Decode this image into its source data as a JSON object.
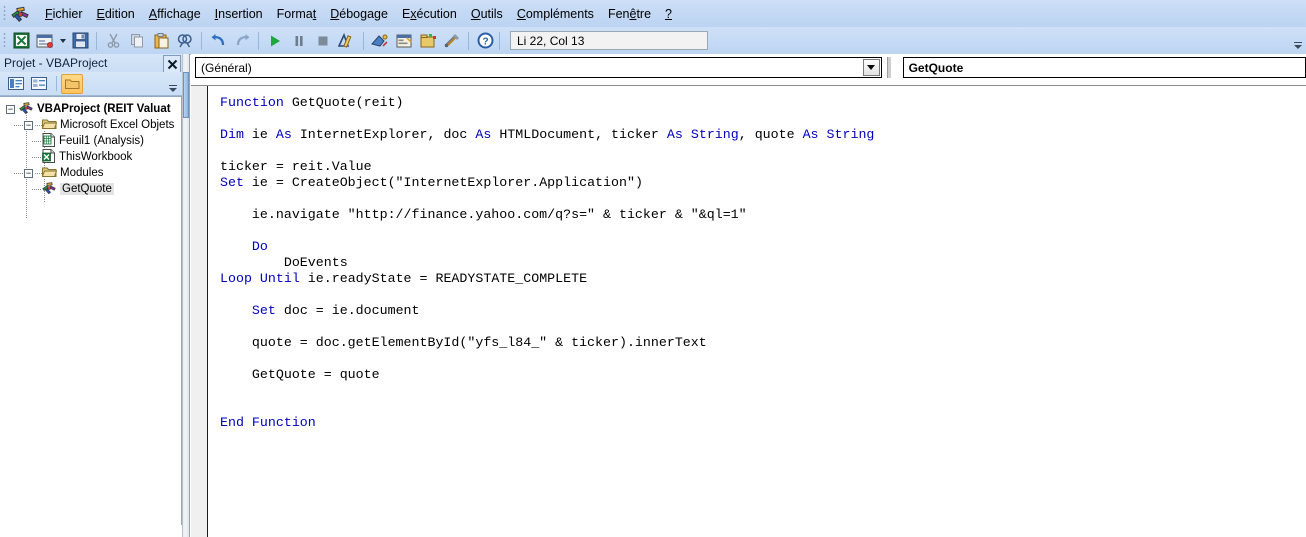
{
  "window": {
    "app_icon": "vba-logo-icon"
  },
  "menubar": {
    "items": [
      {
        "label": "Fichier",
        "accel": "F"
      },
      {
        "label": "Edition",
        "accel": "E"
      },
      {
        "label": "Affichage",
        "accel": "A"
      },
      {
        "label": "Insertion",
        "accel": "I"
      },
      {
        "label": "Format",
        "accel": "t"
      },
      {
        "label": "Débogage",
        "accel": "D"
      },
      {
        "label": "Exécution",
        "accel": "x"
      },
      {
        "label": "Outils",
        "accel": "O"
      },
      {
        "label": "Compléments",
        "accel": "C"
      },
      {
        "label": "Fenêtre",
        "accel": "ê"
      },
      {
        "label": "?",
        "accel": "?"
      }
    ]
  },
  "toolbar": {
    "buttons": [
      {
        "name": "view-excel-icon",
        "glyph": "excel"
      },
      {
        "name": "insert-userform-icon",
        "glyph": "userform"
      },
      {
        "name": "insert-dropdown-caret-icon",
        "glyph": "caret"
      },
      {
        "name": "save-icon",
        "glyph": "save"
      },
      {
        "name": "cut-icon",
        "glyph": "cut"
      },
      {
        "name": "copy-icon",
        "glyph": "copy"
      },
      {
        "name": "paste-icon",
        "glyph": "paste"
      },
      {
        "name": "find-icon",
        "glyph": "find"
      },
      {
        "name": "undo-icon",
        "glyph": "undo"
      },
      {
        "name": "redo-icon",
        "glyph": "redo"
      },
      {
        "name": "run-icon",
        "glyph": "run"
      },
      {
        "name": "pause-icon",
        "glyph": "pause"
      },
      {
        "name": "stop-icon",
        "glyph": "stop"
      },
      {
        "name": "design-mode-icon",
        "glyph": "design"
      },
      {
        "name": "project-explorer-icon",
        "glyph": "projexp"
      },
      {
        "name": "properties-window-icon",
        "glyph": "props"
      },
      {
        "name": "object-browser-icon",
        "glyph": "objbrowser"
      },
      {
        "name": "toolbox-icon",
        "glyph": "toolbox"
      },
      {
        "name": "help-icon",
        "glyph": "help"
      }
    ],
    "position_indicator": "Li 22, Col 13"
  },
  "project_explorer": {
    "title": "Projet - VBAProject",
    "close_label": "×",
    "toolbar_buttons": [
      {
        "name": "view-code-icon"
      },
      {
        "name": "view-object-icon"
      },
      {
        "name": "toggle-folders-icon"
      }
    ],
    "tree": {
      "root": {
        "label": "VBAProject (REIT Valuat",
        "expander": "−",
        "icon": "vbaproject-icon"
      },
      "groups": [
        {
          "label": "Microsoft Excel Objets",
          "expander": "−",
          "icon": "folder-icon",
          "children": [
            {
              "label": "Feuil1 (Analysis)",
              "icon": "worksheet-icon",
              "selected": false
            },
            {
              "label": "ThisWorkbook",
              "icon": "workbook-icon",
              "selected": false
            }
          ]
        },
        {
          "label": "Modules",
          "expander": "−",
          "icon": "folder-icon",
          "children": [
            {
              "label": "GetQuote",
              "icon": "module-icon",
              "selected": true
            }
          ]
        }
      ]
    }
  },
  "code_window": {
    "object_dropdown": {
      "value": "(Général)",
      "icon": "chevron-down-icon"
    },
    "procedure_dropdown": {
      "value": "GetQuote"
    },
    "code_lines": [
      [
        {
          "t": "Function",
          "c": "kw"
        },
        {
          "t": " GetQuote(reit)",
          "c": ""
        }
      ],
      [],
      [
        {
          "t": "Dim",
          "c": "kw"
        },
        {
          "t": " ie ",
          "c": ""
        },
        {
          "t": "As",
          "c": "kw"
        },
        {
          "t": " InternetExplorer, doc ",
          "c": ""
        },
        {
          "t": "As",
          "c": "kw"
        },
        {
          "t": " HTMLDocument, ticker ",
          "c": ""
        },
        {
          "t": "As",
          "c": "kw"
        },
        {
          "t": " String",
          "c": "kw"
        },
        {
          "t": ", quote ",
          "c": ""
        },
        {
          "t": "As",
          "c": "kw"
        },
        {
          "t": " String",
          "c": "kw"
        }
      ],
      [],
      [
        {
          "t": "ticker = reit.Value",
          "c": ""
        }
      ],
      [
        {
          "t": "Set",
          "c": "kw"
        },
        {
          "t": " ie = CreateObject(\"InternetExplorer.Application\")",
          "c": ""
        }
      ],
      [],
      [
        {
          "t": "    ie.navigate \"http://finance.yahoo.com/q?s=\" & ticker & \"&ql=1\"",
          "c": ""
        }
      ],
      [],
      [
        {
          "t": "    ",
          "c": ""
        },
        {
          "t": "Do",
          "c": "kw"
        }
      ],
      [
        {
          "t": "        DoEvents",
          "c": ""
        }
      ],
      [
        {
          "t": "Loop",
          "c": "kw"
        },
        {
          "t": " ",
          "c": ""
        },
        {
          "t": "Until",
          "c": "kw"
        },
        {
          "t": " ie.readyState = READYSTATE_COMPLETE",
          "c": ""
        }
      ],
      [],
      [
        {
          "t": "    ",
          "c": ""
        },
        {
          "t": "Set",
          "c": "kw"
        },
        {
          "t": " doc = ie.document",
          "c": ""
        }
      ],
      [],
      [
        {
          "t": "    quote = doc.getElementById(\"yfs_l84_\" & ticker).innerText",
          "c": ""
        }
      ],
      [],
      [
        {
          "t": "    GetQuote = quote",
          "c": ""
        }
      ],
      [],
      [],
      [
        {
          "t": "End Function",
          "c": "kw"
        }
      ]
    ]
  },
  "colors": {
    "keyword": "#0000c0",
    "code_bg": "#ffffff",
    "toolbar_bg": "#c6dbf5",
    "selection_bg": "#e4e4e4",
    "folder": "#e8c96a"
  }
}
